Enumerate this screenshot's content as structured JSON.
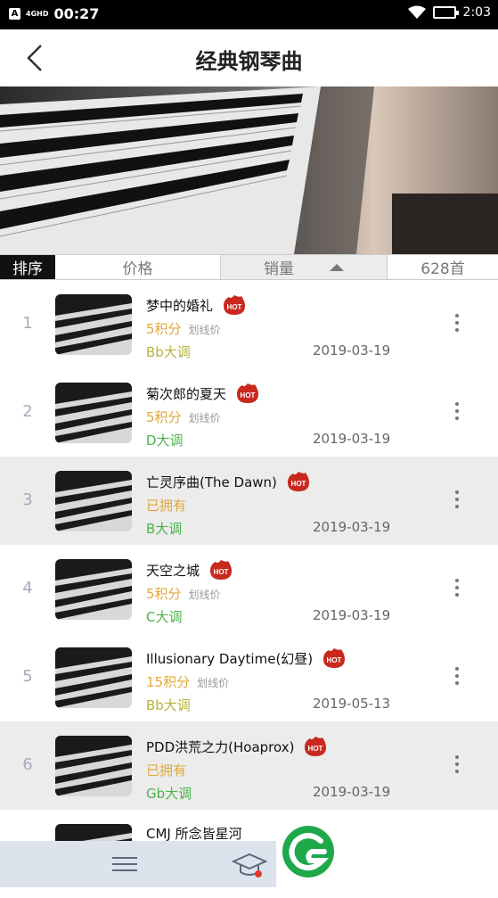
{
  "status_bar": {
    "left_badge": "A",
    "network": "4GHD",
    "time": "00:27",
    "right_time": "2:03"
  },
  "header": {
    "title": "经典钢琴曲"
  },
  "sortbar": {
    "label": "排序",
    "price": "价格",
    "sales": "销量",
    "count": "628首"
  },
  "colors": {
    "price": "#e0a83a",
    "key_major": "#4db34d",
    "key_bb": "#b8b23a",
    "hot": "#c8281e"
  },
  "songs": [
    {
      "index": "1",
      "name": "梦中的婚礼",
      "hot": "HOT",
      "price": "5积分",
      "strike": "划线价",
      "key": "Bb大调",
      "date": "2019-03-19"
    },
    {
      "index": "2",
      "name": "菊次郎的夏天",
      "hot": "HOT",
      "price": "5积分",
      "strike": "划线价",
      "key": "D大调",
      "date": "2019-03-19"
    },
    {
      "index": "3",
      "name": "亡灵序曲(The Dawn)",
      "hot": "HOT",
      "price": "已拥有",
      "strike": "",
      "key": "B大调",
      "date": "2019-03-19"
    },
    {
      "index": "4",
      "name": "天空之城",
      "hot": "HOT",
      "price": "5积分",
      "strike": "划线价",
      "key": "C大调",
      "date": "2019-03-19"
    },
    {
      "index": "5",
      "name": "Illusionary Daytime(幻昼)",
      "hot": "HOT",
      "price": "15积分",
      "strike": "划线价",
      "key": "Bb大调",
      "date": "2019-05-13"
    },
    {
      "index": "6",
      "name": "PDD洪荒之力(Hoaprox)",
      "hot": "HOT",
      "price": "已拥有",
      "strike": "",
      "key": "Gb大调",
      "date": "2019-03-19"
    },
    {
      "index": "",
      "name": "CMJ 所念皆星河",
      "hot": "",
      "price": "",
      "strike": "",
      "key": "",
      "date": ""
    }
  ]
}
